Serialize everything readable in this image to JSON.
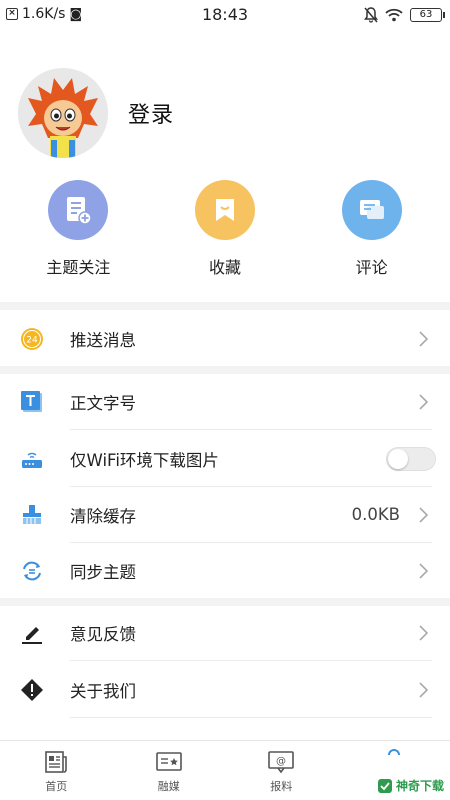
{
  "status_bar": {
    "speed": "1.6K/s",
    "time": "18:43",
    "battery": "63"
  },
  "profile": {
    "login_label": "登录"
  },
  "quick_actions": [
    {
      "label": "主题关注",
      "icon": "topic-follow-icon",
      "color": "#8fa2e6"
    },
    {
      "label": "收藏",
      "icon": "bookmark-icon",
      "color": "#f6c360"
    },
    {
      "label": "评论",
      "icon": "comment-icon",
      "color": "#6fb3ec"
    }
  ],
  "menu": {
    "push": {
      "label": "推送消息",
      "badge": "24"
    },
    "font_size": {
      "label": "正文字号"
    },
    "wifi_images": {
      "label": "仅WiFi环境下载图片",
      "enabled": false
    },
    "clear_cache": {
      "label": "清除缓存",
      "value": "0.0KB"
    },
    "sync_theme": {
      "label": "同步主题"
    },
    "feedback": {
      "label": "意见反馈"
    },
    "about": {
      "label": "关于我们"
    }
  },
  "tabbar": {
    "items": [
      {
        "label": "首页",
        "icon": "news-icon"
      },
      {
        "label": "融媒",
        "icon": "media-icon"
      },
      {
        "label": "报料",
        "icon": "report-icon"
      },
      {
        "label": "",
        "icon": "my-icon"
      }
    ],
    "watermark": "神奇下载"
  },
  "colors": {
    "accent_blue": "#3b8fe0",
    "badge_orange": "#f5b622",
    "text_primary": "#222222",
    "divider": "#f3f3f3"
  }
}
